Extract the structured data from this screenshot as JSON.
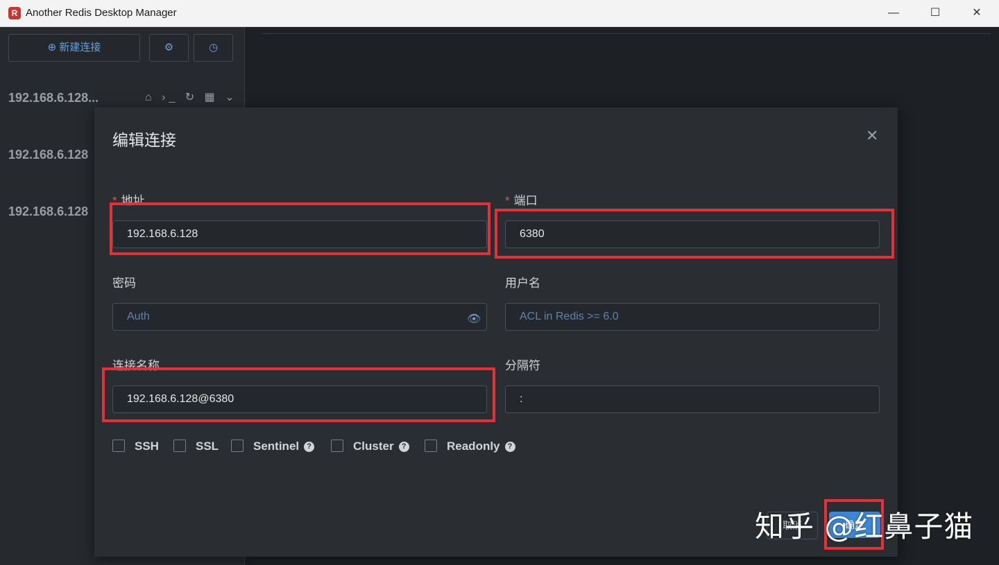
{
  "window": {
    "title": "Another Redis Desktop Manager",
    "app_icon_glyph": "R",
    "min_glyph": "—",
    "max_glyph": "☐",
    "close_glyph": "✕"
  },
  "toolbar": {
    "new_connection_label": "新建连接",
    "new_connection_icon": "⊕",
    "settings_icon": "⚙",
    "history_icon": "◷"
  },
  "connections": [
    {
      "label": "192.168.6.128..."
    },
    {
      "label": "192.168.6.128"
    },
    {
      "label": "192.168.6.128"
    }
  ],
  "connection_icons": "⌂ ›_ ↻ ▦ ⌄",
  "dialog": {
    "title": "编辑连接",
    "close_glyph": "✕",
    "required_mark": "*",
    "fields": {
      "address": {
        "label": "地址",
        "value": "192.168.6.128"
      },
      "port": {
        "label": "端口",
        "value": "6380"
      },
      "password": {
        "label": "密码",
        "placeholder": "Auth"
      },
      "username": {
        "label": "用户名",
        "placeholder": "ACL in Redis >= 6.0"
      },
      "name": {
        "label": "连接名称",
        "value": "192.168.6.128@6380"
      },
      "separator": {
        "label": "分隔符",
        "value": ":"
      }
    },
    "eye_glyph": "👁",
    "help_glyph": "?",
    "options": [
      {
        "label": "SSH",
        "help": false
      },
      {
        "label": "SSL",
        "help": false
      },
      {
        "label": "Sentinel",
        "help": true
      },
      {
        "label": "Cluster",
        "help": true
      },
      {
        "label": "Readonly",
        "help": true
      }
    ],
    "cancel_label": "取消",
    "ok_label": "确定"
  },
  "watermark": "知乎 @红鼻子猫",
  "colors": {
    "accent": "#3d86d4",
    "highlight": "#e03238",
    "required": "#e05252"
  }
}
